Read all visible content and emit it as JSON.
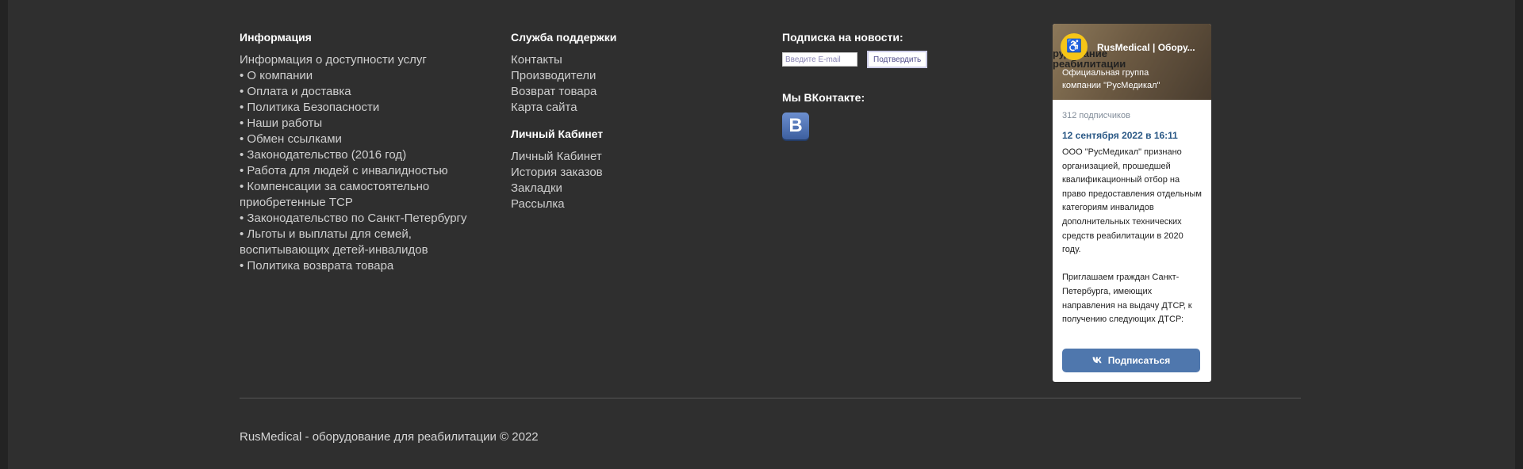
{
  "info": {
    "title": "Информация",
    "items": [
      "Информация о доступности услуг",
      "• О компании",
      "• Оплата и доставка",
      "• Политика Безопасности",
      "• Наши работы",
      "• Обмен ссылками",
      "• Законодательство (2016 год)",
      "• Работа для людей с инвалидностью",
      "• Компенсации за самостоятельно приобретенные ТСР",
      "• Законодательство по Санкт-Петербургу",
      "• Льготы и выплаты для семей, воспитывающих детей-инвалидов",
      "• Политика возврата товара"
    ]
  },
  "support": {
    "title": "Служба поддержки",
    "items": [
      "Контакты",
      "Производители",
      "Возврат товара",
      "Карта сайта"
    ]
  },
  "account": {
    "title": "Личный Кабинет",
    "items": [
      "Личный Кабинет",
      "История заказов",
      "Закладки",
      "Рассылка"
    ]
  },
  "subscribe": {
    "title": "Подписка на новости:",
    "email_placeholder": "Введите E-mail",
    "confirm_label": "Подтвердить"
  },
  "vk_block": {
    "title": "Мы ВКонтакте:",
    "icon_letter": "B",
    "icon": "vk-logo-icon"
  },
  "vk_widget": {
    "group_name": "RusMedical | Обору...",
    "header_bg_text": "рудование\nреабилитации",
    "description": "Официальная группа компании \"РусМедикал\"",
    "subscribers": "312 подписчиков",
    "post_date": "12 сентября 2022 в 16:11",
    "post_text": "ООО \"РусМедикал\" признано организацией, прошедшей квалификационный отбор на право предоставления отдельным категориям инвалидов дополнительных технических средств реабилитации в 2020 году.\n\nПриглашаем граждан Санкт-Петербурга, имеющих направления на выдачу ДТСР, к получению следующих ДТСР:",
    "button_label": "Подписаться",
    "button_icon": "vk-icon",
    "avatar_icon": "wheelchair-logo-icon",
    "accent": "#4f77ad"
  },
  "copyright": "RusMedical - оборудование для реабилитации © 2022"
}
